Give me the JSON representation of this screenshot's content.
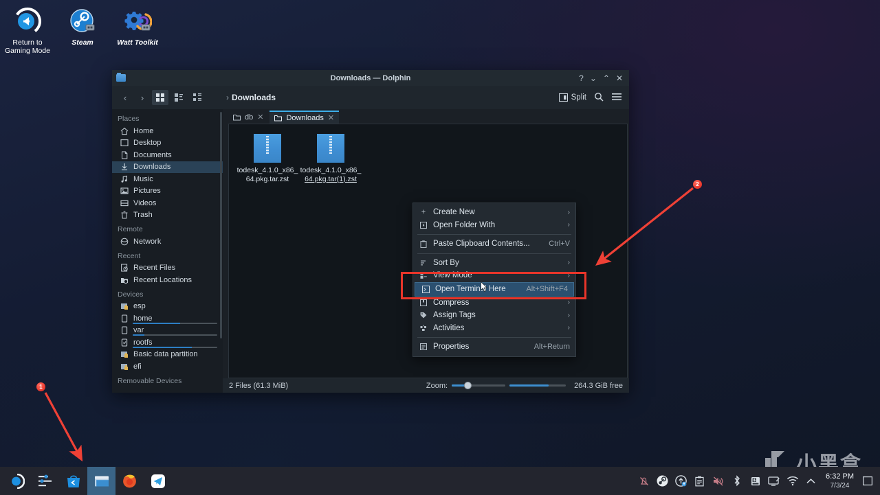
{
  "desktop": {
    "icons": [
      {
        "name": "return-to-gaming-mode",
        "label": "Return to\nGaming Mode",
        "icon": "return-arrow-icon"
      },
      {
        "name": "steam",
        "label": "Steam",
        "icon": "steam-icon"
      },
      {
        "name": "watt-toolkit",
        "label": "Watt Toolkit",
        "icon": "gear-icon"
      }
    ]
  },
  "window": {
    "title": "Downloads — Dolphin",
    "titlebar_buttons": [
      {
        "name": "help-button",
        "glyph": "?"
      },
      {
        "name": "minimize-button",
        "glyph": "⌄"
      },
      {
        "name": "maximize-button",
        "glyph": "⌃"
      },
      {
        "name": "close-button",
        "glyph": "✕"
      }
    ],
    "toolbar": {
      "back": "‹",
      "forward": "›",
      "view_icons_label": "icon-view-icon",
      "view_compact_label": "compact-view-icon",
      "view_details_label": "details-view-icon",
      "breadcrumb_chevron": "›",
      "breadcrumb_path": "Downloads",
      "split_label": "Split",
      "search_label": "search-icon",
      "menu_label": "hamburger-menu-icon"
    },
    "sidebar": {
      "sections": [
        {
          "title": "Places",
          "items": [
            {
              "label": "Home",
              "icon": "home-icon",
              "selected": false
            },
            {
              "label": "Desktop",
              "icon": "desktop-icon",
              "selected": false
            },
            {
              "label": "Documents",
              "icon": "document-icon",
              "selected": false
            },
            {
              "label": "Downloads",
              "icon": "download-icon",
              "selected": true
            },
            {
              "label": "Music",
              "icon": "music-note-icon",
              "selected": false
            },
            {
              "label": "Pictures",
              "icon": "image-icon",
              "selected": false
            },
            {
              "label": "Videos",
              "icon": "video-icon",
              "selected": false
            },
            {
              "label": "Trash",
              "icon": "trash-icon",
              "selected": false
            }
          ]
        },
        {
          "title": "Remote",
          "items": [
            {
              "label": "Network",
              "icon": "network-icon",
              "selected": false
            }
          ]
        },
        {
          "title": "Recent",
          "items": [
            {
              "label": "Recent Files",
              "icon": "recent-file-icon",
              "selected": false
            },
            {
              "label": "Recent Locations",
              "icon": "recent-folder-icon",
              "selected": false
            }
          ]
        },
        {
          "title": "Devices",
          "items": [
            {
              "label": "esp",
              "icon": "drive-lock-icon",
              "selected": false
            },
            {
              "label": "home",
              "icon": "drive-icon",
              "selected": false,
              "usage": 56
            },
            {
              "label": "var",
              "icon": "drive-icon",
              "selected": false,
              "usage": 14
            },
            {
              "label": "rootfs",
              "icon": "drive-check-icon",
              "selected": false,
              "usage": 70
            },
            {
              "label": "Basic data partition",
              "icon": "drive-lock-icon",
              "selected": false
            },
            {
              "label": "efi",
              "icon": "drive-lock-icon",
              "selected": false
            }
          ]
        },
        {
          "title": "Removable Devices",
          "items": []
        }
      ]
    },
    "tabs": [
      {
        "label": "db",
        "active": false,
        "close": "✕"
      },
      {
        "label": "Downloads",
        "active": true,
        "close": "✕"
      }
    ],
    "files": [
      {
        "name": "todesk_4.1.0_x86_64.pkg.tar.zst",
        "line1": "todesk_4.1.0_x86_",
        "line2": "64.pkg.tar.zst",
        "icon": "archive-icon",
        "underlined": false
      },
      {
        "name": "todesk_4.1.0_x86_64.pkg.tar(1).zst",
        "line1": "todesk_4.1.0_x86_",
        "line2": "64.pkg.tar(1).zst",
        "icon": "archive-icon",
        "underlined": true
      }
    ],
    "statusbar": {
      "file_count": "2 Files (61.3 MiB)",
      "zoom_label": "Zoom:",
      "free_space": "264.3 GiB free"
    }
  },
  "context_menu": {
    "items": [
      {
        "label": "Create New",
        "icon": "plus-icon",
        "submenu": true,
        "shortcut": "",
        "highlighted": false
      },
      {
        "label": "Open Folder With",
        "icon": "open-with-icon",
        "submenu": true,
        "shortcut": "",
        "highlighted": false
      },
      {
        "separator_after": true,
        "label": "",
        "icon": "",
        "submenu": false,
        "shortcut": "",
        "highlighted": false
      },
      {
        "label": "Paste Clipboard Contents...",
        "icon": "clipboard-icon",
        "submenu": false,
        "shortcut": "Ctrl+V",
        "highlighted": false
      },
      {
        "separator_after": true,
        "label": "",
        "icon": "",
        "submenu": false,
        "shortcut": "",
        "highlighted": false
      },
      {
        "label": "Sort By",
        "icon": "sort-icon",
        "submenu": true,
        "shortcut": "",
        "highlighted": false
      },
      {
        "label": "View Mode",
        "icon": "view-mode-icon",
        "submenu": true,
        "shortcut": "",
        "highlighted": false
      },
      {
        "label": "Open Terminal Here",
        "icon": "terminal-icon",
        "submenu": false,
        "shortcut": "Alt+Shift+F4",
        "highlighted": true
      },
      {
        "label": "Compress",
        "icon": "compress-icon",
        "submenu": true,
        "shortcut": "",
        "highlighted": false
      },
      {
        "label": "Assign Tags",
        "icon": "tag-icon",
        "submenu": true,
        "shortcut": "",
        "highlighted": false
      },
      {
        "label": "Activities",
        "icon": "activities-icon",
        "submenu": true,
        "shortcut": "",
        "highlighted": false
      },
      {
        "separator_after": true,
        "label": "",
        "icon": "",
        "submenu": false,
        "shortcut": "",
        "highlighted": false
      },
      {
        "label": "Properties",
        "icon": "properties-icon",
        "submenu": false,
        "shortcut": "Alt+Return",
        "highlighted": false
      }
    ]
  },
  "annotations": [
    {
      "number": "1",
      "target": "file-manager-taskbar-icon"
    },
    {
      "number": "2",
      "target": "open-terminal-here-menu-item"
    }
  ],
  "taskbar": {
    "apps": [
      {
        "name": "app-launcher",
        "active": false
      },
      {
        "name": "settings",
        "active": false
      },
      {
        "name": "discover-store",
        "active": false
      },
      {
        "name": "file-manager",
        "active": true
      },
      {
        "name": "firefox",
        "active": false
      },
      {
        "name": "telegram",
        "active": false
      }
    ],
    "tray": [
      {
        "name": "notifications-muted-icon"
      },
      {
        "name": "steam-tray-icon"
      },
      {
        "name": "updates-icon"
      },
      {
        "name": "clipboard-icon"
      },
      {
        "name": "volume-muted-icon"
      },
      {
        "name": "bluetooth-icon"
      },
      {
        "name": "storage-icon"
      },
      {
        "name": "display-icon"
      },
      {
        "name": "wifi-icon"
      },
      {
        "name": "show-hidden-icon"
      }
    ],
    "clock": {
      "time": "6:32 PM",
      "date": "7/3/24"
    }
  },
  "watermark": {
    "text": "小黑盒"
  },
  "colors": {
    "accent": "#3daee9",
    "highlight": "#2b5070",
    "annotation_red": "#e8352a",
    "window_bg": "#1b2026",
    "sidebar_bg": "#181d23"
  }
}
